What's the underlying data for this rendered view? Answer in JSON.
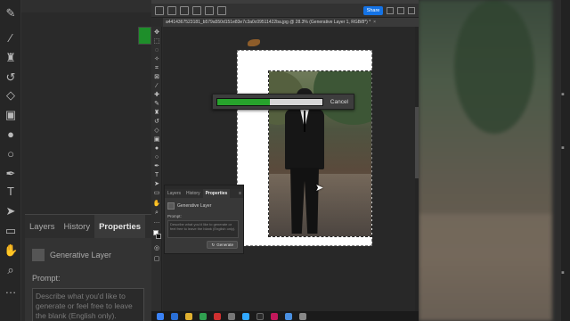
{
  "document_tab": {
    "title": "a4414367523181_b579a550d151e83e7c3a0c09511422ba.jpg @ 28.3% (Generative Layer 1, RGB/8*) *",
    "close": "×"
  },
  "options_bar": {
    "share_label": "Share"
  },
  "progress": {
    "fraction": 0.5,
    "cancel_label": "Cancel",
    "fill_color": "#27a32c"
  },
  "properties_panel": {
    "tabs": [
      "Layers",
      "History",
      "Properties"
    ],
    "active_tab": "Properties",
    "layer_type": "Generative Layer",
    "prompt_label": "Prompt:",
    "prompt_placeholder": "Describe what you'd like to generate or feel free to leave the blank (English only).",
    "generate_label": "Generate",
    "menu_icon": "≡"
  },
  "background_panel": {
    "tabs": [
      "Layers",
      "History",
      "Properties"
    ],
    "layer_type": "Generative Layer",
    "prompt_label": "Prompt:",
    "prompt_placeholder": "Describe what you'd like to generate or feel free to leave the blank (English only)."
  },
  "colors": {
    "accent": "#1473e6",
    "progress_green": "#27a32c",
    "foreground_swatch": "#1e8e2a"
  }
}
